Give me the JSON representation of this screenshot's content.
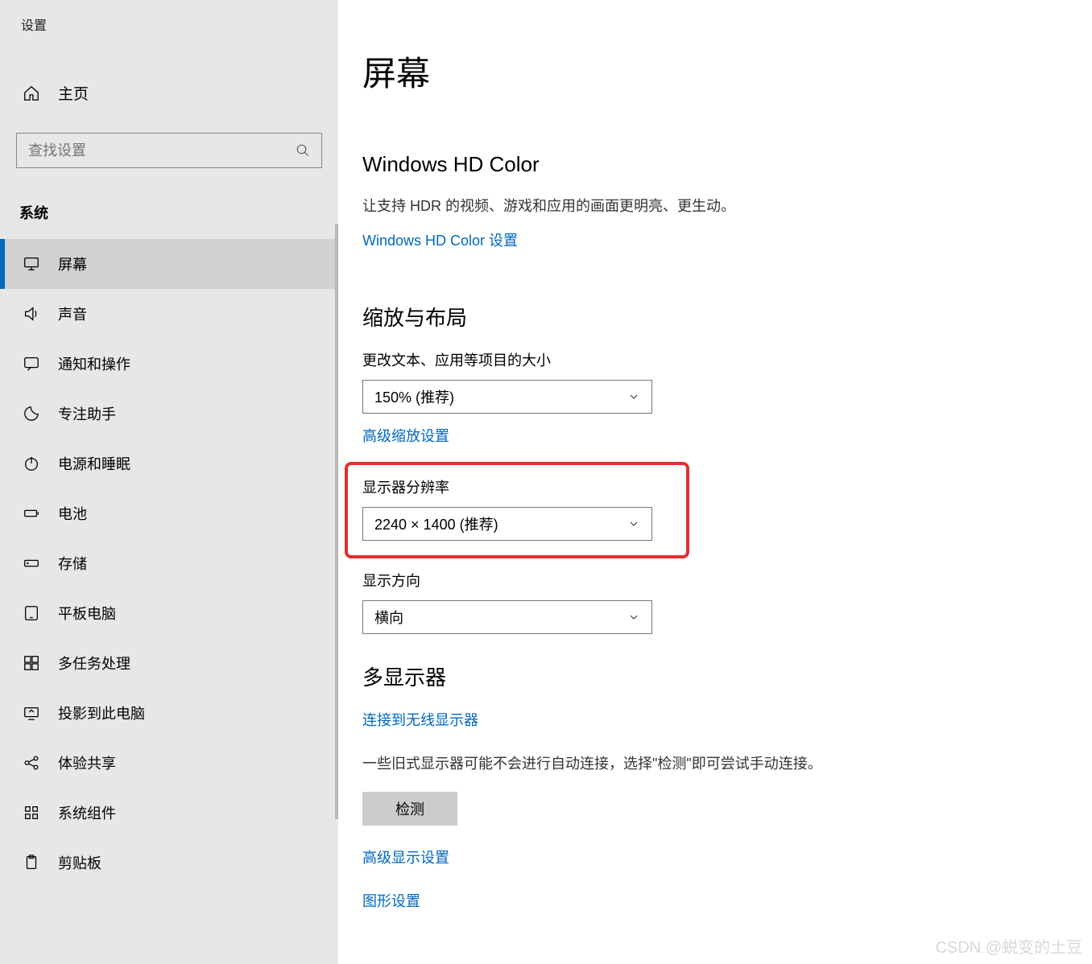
{
  "window_title": "设置",
  "home_label": "主页",
  "search_placeholder": "查找设置",
  "category": "系统",
  "nav": [
    {
      "id": "display",
      "label": "屏幕",
      "active": true,
      "icon": "monitor"
    },
    {
      "id": "sound",
      "label": "声音",
      "icon": "speaker"
    },
    {
      "id": "notifications",
      "label": "通知和操作",
      "icon": "chat"
    },
    {
      "id": "focus",
      "label": "专注助手",
      "icon": "moon"
    },
    {
      "id": "power",
      "label": "电源和睡眠",
      "icon": "power"
    },
    {
      "id": "battery",
      "label": "电池",
      "icon": "battery"
    },
    {
      "id": "storage",
      "label": "存储",
      "icon": "drive"
    },
    {
      "id": "tablet",
      "label": "平板电脑",
      "icon": "tablet"
    },
    {
      "id": "multitask",
      "label": "多任务处理",
      "icon": "multitask"
    },
    {
      "id": "project",
      "label": "投影到此电脑",
      "icon": "project"
    },
    {
      "id": "shared",
      "label": "体验共享",
      "icon": "shared"
    },
    {
      "id": "syscomp",
      "label": "系统组件",
      "icon": "grid"
    },
    {
      "id": "clipboard",
      "label": "剪贴板",
      "icon": "clipboard"
    }
  ],
  "main": {
    "title": "屏幕",
    "hdcolor": {
      "heading": "Windows HD Color",
      "desc": "让支持 HDR 的视频、游戏和应用的画面更明亮、更生动。",
      "link": "Windows HD Color 设置"
    },
    "scale": {
      "heading": "缩放与布局",
      "label_scale": "更改文本、应用等项目的大小",
      "value_scale": "150% (推荐)",
      "link_advanced_scale": "高级缩放设置",
      "label_resolution": "显示器分辨率",
      "value_resolution": "2240 × 1400 (推荐)",
      "label_orientation": "显示方向",
      "value_orientation": "横向"
    },
    "multi": {
      "heading": "多显示器",
      "link_wireless": "连接到无线显示器",
      "desc_legacy": "一些旧式显示器可能不会进行自动连接，选择\"检测\"即可尝试手动连接。",
      "btn_detect": "检测",
      "link_adv_display": "高级显示设置",
      "link_graphics": "图形设置"
    }
  },
  "watermark": "CSDN @蜕变的土豆"
}
